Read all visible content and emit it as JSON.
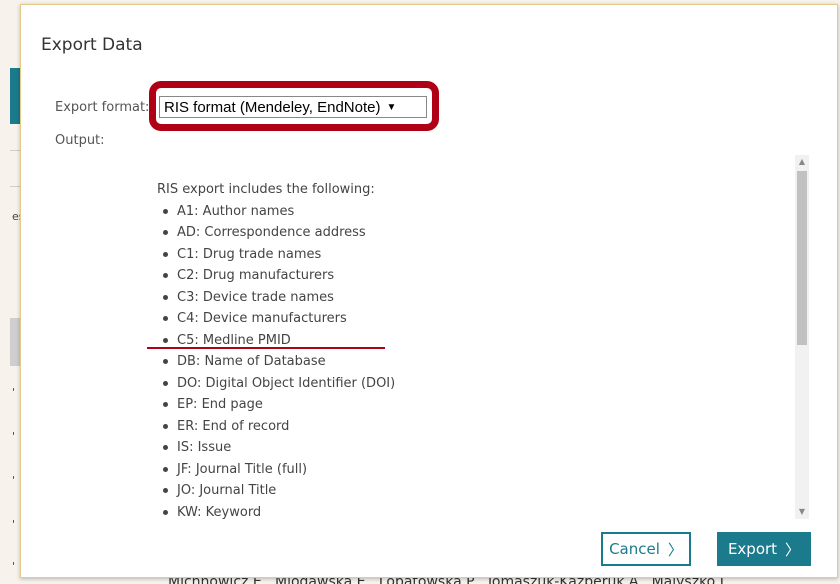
{
  "background": {
    "bottom_text": "Michnowicz E., Mlodawska E., Lopatowska P., Tomaszuk-Kazberuk A., Malyszko J.",
    "side_marks": [
      "es",
      "'",
      "'",
      "'",
      "'",
      "'"
    ]
  },
  "dialog": {
    "title": "Export Data",
    "export_format_label": "Export format:",
    "export_format_value": "RIS format (Mendeley, EndNote)",
    "output_label": "Output:",
    "output_intro": "RIS export includes the following:",
    "output_items": [
      "A1: Author names",
      "AD: Correspondence address",
      "C1: Drug trade names",
      "C2: Drug manufacturers",
      "C3: Device trade names",
      "C4: Device manufacturers",
      "C5: Medline PMID",
      "DB: Name of Database",
      "DO: Digital Object Identifier (DOI)",
      "EP: End page",
      "ER: End of record",
      "IS: Issue",
      "JF: Journal Title (full)",
      "JO: Journal Title",
      "KW: Keyword"
    ],
    "cancel_label": "Cancel",
    "export_label": "Export"
  },
  "colors": {
    "accent": "#1b7a8c",
    "highlight": "#b00015"
  },
  "icons": {
    "select_caret": "▼",
    "chevron": "〉",
    "scroll_up": "▲",
    "scroll_down": "▼"
  }
}
